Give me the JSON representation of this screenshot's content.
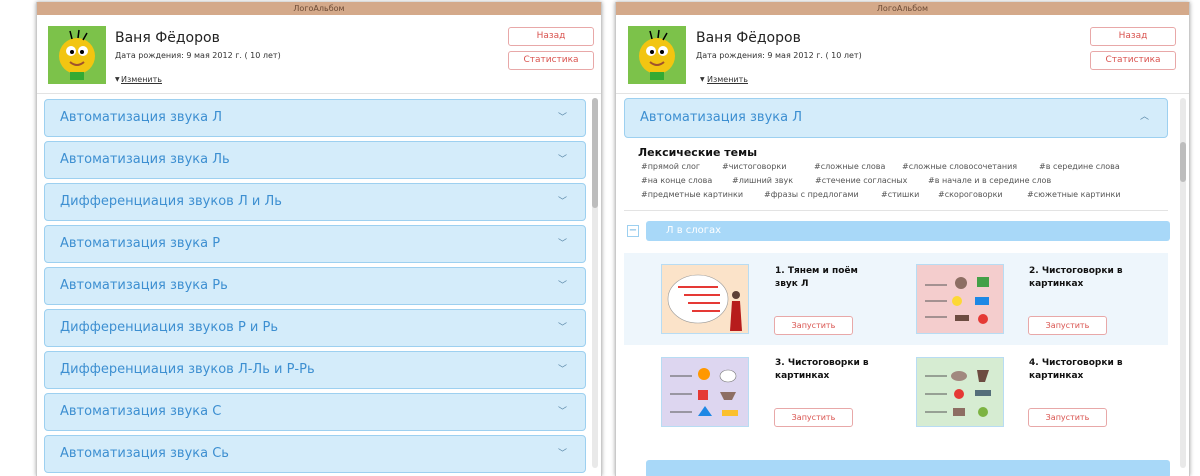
{
  "app_title": "ЛогоАльбом",
  "profile": {
    "name": "Ваня Фёдоров",
    "birth": "Дата рождения: 9 мая 2012 г. ( 10 лет)",
    "change": "Изменить"
  },
  "buttons": {
    "back": "Назад",
    "stats": "Статистика"
  },
  "sections": [
    "Автоматизация звука Л",
    "Автоматизация звука Ль",
    "Дифференциация звуков Л и Ль",
    "Автоматизация звука Р",
    "Автоматизация звука Рь",
    "Дифференциация звуков Р и Рь",
    "Дифференциация звуков Л-Ль и Р-Рь",
    "Автоматизация звука С",
    "Автоматизация звука Сь"
  ],
  "lexical": {
    "title": "Лексические темы",
    "tags": [
      "#прямой слог",
      "#чистоговорки",
      "#сложные слова",
      "#сложные словосочетания",
      "#в середине слова",
      "#на конце слова",
      "#лишний звук",
      "#стечение согласных",
      "#в начале и в середине слов",
      "#предметные картинки",
      "#фразы с предлогами",
      "#стишки",
      "#скороговорки",
      "#сюжетные картинки"
    ]
  },
  "subsection": "Л в слогах",
  "exercises": [
    {
      "title": "1. Тянем и поём звук Л",
      "button": "Запустить"
    },
    {
      "title": "2. Чистоговорки в картинках",
      "button": "Запустить"
    },
    {
      "title": "3. Чистоговорки в картинках",
      "button": "Запустить"
    },
    {
      "title": "4. Чистоговорки в картинках",
      "button": "Запустить"
    }
  ],
  "icons": {
    "expand": "chevron-down-icon",
    "collapse": "chevron-up-icon",
    "toggle": "minus-icon",
    "change": "caret-down-icon"
  },
  "colors": {
    "titlebar": "#d4a98a",
    "accordion_bg": "#d4ecfa",
    "accordion_text": "#3d8fd1",
    "button_text": "#d9534f",
    "avatar_bg": "#7cc24a"
  }
}
